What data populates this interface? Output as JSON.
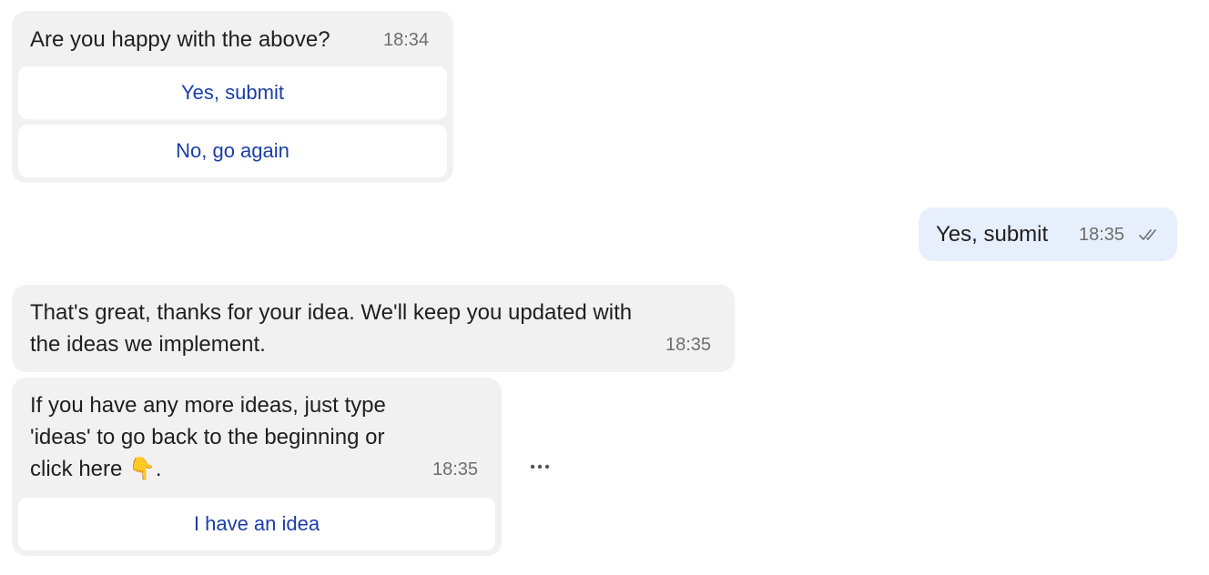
{
  "messages": [
    {
      "text": "Are you happy with the above?",
      "time": "18:34",
      "buttons": [
        "Yes, submit",
        "No, go again"
      ]
    },
    {
      "text": "Yes, submit",
      "time": "18:35",
      "status_icon": "double-check-icon"
    },
    {
      "text_line1": "That's great, thanks for your idea. We'll keep you updated with",
      "text_line2": "the ideas we implement.",
      "time": "18:35"
    },
    {
      "text_line1": "If you have any more ideas, just type",
      "text_line2": "'ideas' to go back to the beginning or",
      "text_line3": "click here 👇.",
      "time": "18:35",
      "buttons": [
        "I have an idea"
      ]
    }
  ],
  "more_icon": "more-horizontal-icon",
  "colors": {
    "incoming_bubble": "#f1f1f1",
    "outgoing_bubble": "#e7eefc",
    "button_text": "#1a3fa8",
    "timestamp": "#6e6e6e"
  }
}
